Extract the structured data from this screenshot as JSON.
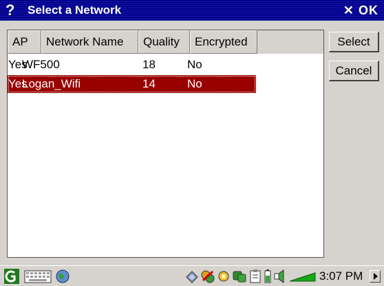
{
  "window": {
    "title": "Select a Network",
    "help_icon": "?",
    "ok_label": "OK",
    "close_glyph": "✕"
  },
  "table": {
    "columns": [
      "AP",
      "Network Name",
      "Quality",
      "Encrypted"
    ],
    "rows": [
      {
        "ap": "Yes",
        "name": "WF500",
        "quality": "18",
        "encrypted": "No",
        "selected": false
      },
      {
        "ap": "Yes",
        "name": "Logan_Wifi",
        "quality": "14",
        "encrypted": "No",
        "selected": true
      }
    ]
  },
  "buttons": {
    "select_label": "Select",
    "cancel_label": "Cancel"
  },
  "taskbar": {
    "left_icons": [
      "start-icon",
      "keyboard-icon",
      "globe-icon"
    ],
    "tray_icons": [
      "pen-icon",
      "network-icon",
      "search-icon",
      "connection-icon",
      "clipboard-icon",
      "battery-icon",
      "volume-icon",
      "signal-icon"
    ],
    "clock": "3:07 PM"
  },
  "colors": {
    "titlebar": "#000090",
    "selection": "#990000",
    "background": "#d6d3ce"
  }
}
